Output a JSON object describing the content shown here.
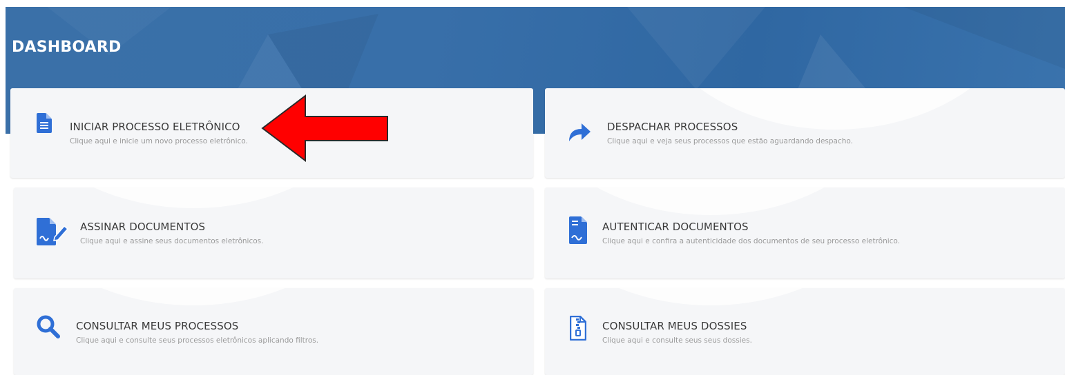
{
  "header": {
    "title": "DASHBOARD"
  },
  "cards": [
    {
      "title": "INICIAR PROCESSO ELETRÔNICO",
      "description": "Clique aqui e inicie um novo processo eletrônico.",
      "icon": "document-icon"
    },
    {
      "title": "DESPACHAR PROCESSOS",
      "description": "Clique aqui e veja seus processos que estão aguardando despacho.",
      "icon": "share-arrow-icon"
    },
    {
      "title": "ASSINAR DOCUMENTOS",
      "description": "Clique aqui e assine seus documentos eletrônicos.",
      "icon": "sign-document-icon"
    },
    {
      "title": "AUTENTICAR DOCUMENTOS",
      "description": "Clique aqui e confira a autenticidade dos documentos de seu processo eletrônico.",
      "icon": "signed-file-icon"
    },
    {
      "title": "CONSULTAR MEUS PROCESSOS",
      "description": "Clique aqui e consulte seus processos eletrônicos aplicando filtros.",
      "icon": "search-icon"
    },
    {
      "title": "CONSULTAR MEUS DOSSIES",
      "description": "Clique aqui e consulte seus seus dossies.",
      "icon": "zip-file-icon"
    }
  ],
  "colors": {
    "header": "#386fa9",
    "icon": "#2f6fd6",
    "annotation_arrow": "#ff0000",
    "card": "#f5f6f8"
  }
}
